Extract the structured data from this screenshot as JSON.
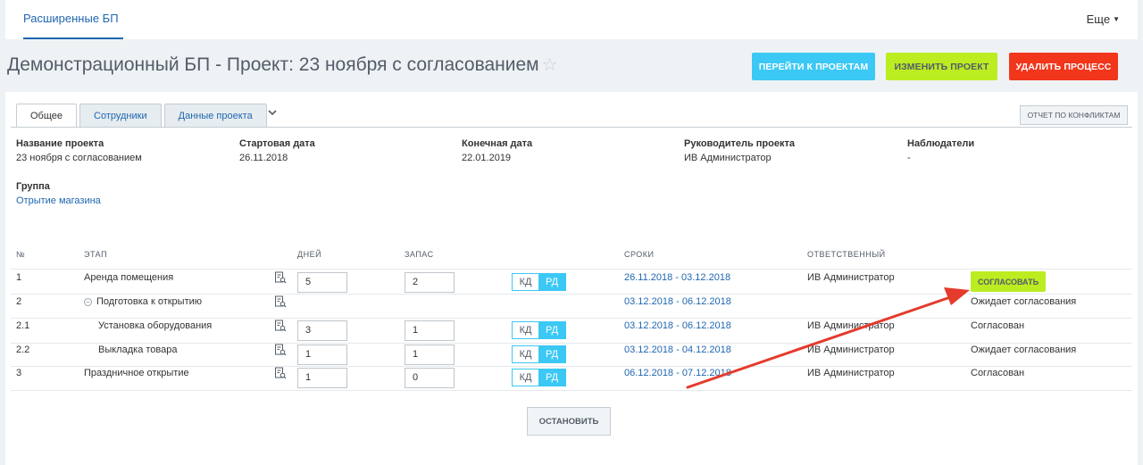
{
  "topnav": {
    "app_tab": "Расширенные БП",
    "more_label": "Еще"
  },
  "header": {
    "title": "Демонстрационный БП - Проект: 23 ноября с согласованием",
    "buttons": {
      "projects": "ПЕРЕЙТИ К ПРОЕКТАМ",
      "edit": "ИЗМЕНИТЬ ПРОЕКТ",
      "delete": "УДАЛИТЬ ПРОЦЕСС"
    }
  },
  "tabs": [
    {
      "label": "Общее",
      "active": true
    },
    {
      "label": "Сотрудники",
      "active": false
    },
    {
      "label": "Данные проекта",
      "active": false
    }
  ],
  "conflict_button": "ОТЧЕТ ПО КОНФЛИКТАМ",
  "info": {
    "project_name": {
      "label": "Название проекта",
      "value": "23 ноября с согласованием"
    },
    "start_date": {
      "label": "Стартовая дата",
      "value": "26.11.2018"
    },
    "end_date": {
      "label": "Конечная дата",
      "value": "22.01.2019"
    },
    "manager": {
      "label": "Руководитель проекта",
      "value": "ИВ Администратор"
    },
    "observers": {
      "label": "Наблюдатели",
      "value": "-"
    },
    "group": {
      "label": "Группа",
      "value": "Отрытие магазина"
    }
  },
  "table": {
    "headers": {
      "num": "№",
      "stage": "ЭТАП",
      "days": "ДНЕЙ",
      "reserve": "ЗАПАС",
      "dates": "СРОКИ",
      "responsible": "ОТВЕТСТВЕННЫЙ"
    },
    "toggle": {
      "kd": "КД",
      "rd": "РД"
    },
    "approve_button": "СОГЛАСОВАТЬ",
    "rows": [
      {
        "num": "1",
        "stage": "Аренда помещения",
        "days": "5",
        "reserve": "2",
        "dates": "26.11.2018 - 03.12.2018",
        "responsible": "ИВ Администратор",
        "status": ""
      },
      {
        "num": "2",
        "stage": "Подготовка к открытию",
        "days": "",
        "reserve": "",
        "dates": "03.12.2018 - 06.12.2018",
        "responsible": "",
        "status": "Ожидает согласования"
      },
      {
        "num": "2.1",
        "stage": "Установка оборудования",
        "days": "3",
        "reserve": "1",
        "dates": "03.12.2018 - 06.12.2018",
        "responsible": "ИВ Администратор",
        "status": "Согласован"
      },
      {
        "num": "2.2",
        "stage": "Выкладка товара",
        "days": "1",
        "reserve": "1",
        "dates": "03.12.2018 - 04.12.2018",
        "responsible": "ИВ Администратор",
        "status": "Ожидает согласования"
      },
      {
        "num": "3",
        "stage": "Праздничное открытие",
        "days": "1",
        "reserve": "0",
        "dates": "06.12.2018 - 07.12.2018",
        "responsible": "ИВ Администратор",
        "status": "Согласован"
      }
    ]
  },
  "stop_button": "ОСТАНОВИТЬ",
  "annotation": {
    "color": "#e53a2c"
  },
  "colors": {
    "accent_blue": "#3bc8f5",
    "accent_green": "#bbed21",
    "accent_red": "#f1361b",
    "link": "#2067b0"
  }
}
